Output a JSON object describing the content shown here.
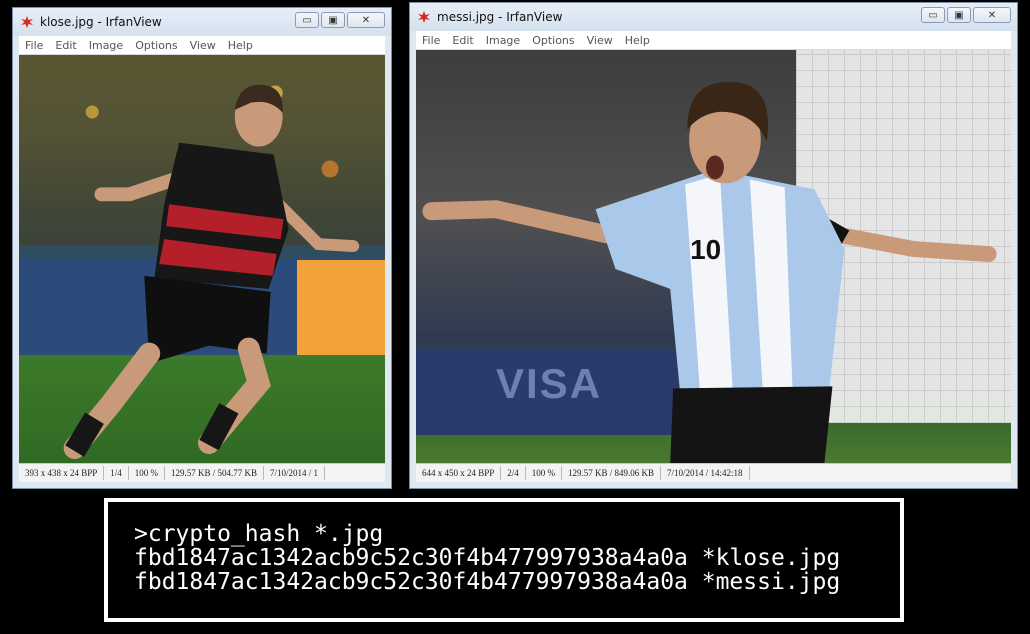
{
  "windows": [
    {
      "title": "klose.jpg - IrfanView",
      "menu": [
        "File",
        "Edit",
        "Image",
        "Options",
        "View",
        "Help"
      ],
      "status": [
        "393 x 438 x 24 BPP",
        "1/4",
        "100 %",
        "129.57 KB / 504.77 KB",
        "7/10/2014 / 1"
      ]
    },
    {
      "title": "messi.jpg - IrfanView",
      "menu": [
        "File",
        "Edit",
        "Image",
        "Options",
        "View",
        "Help"
      ],
      "status": [
        "644 x 450 x 24 BPP",
        "2/4",
        "100 %",
        "129.57 KB / 849.06 KB",
        "7/10/2014 / 14:42:18"
      ]
    }
  ],
  "window_controls": {
    "minimize": "▭",
    "maximize": "▣",
    "close": "✕"
  },
  "icons": {
    "app": "irfanview-red-splat-icon"
  },
  "terminal": {
    "lines": [
      ">crypto_hash *.jpg",
      "fbd1847ac1342acb9c52c30f4b477997938a4a0a *klose.jpg",
      "fbd1847ac1342acb9c52c30f4b477997938a4a0a *messi.jpg"
    ]
  },
  "colors": {
    "background": "#000000",
    "window_frame": "#dfe7f1",
    "terminal_text": "#ffffff"
  }
}
